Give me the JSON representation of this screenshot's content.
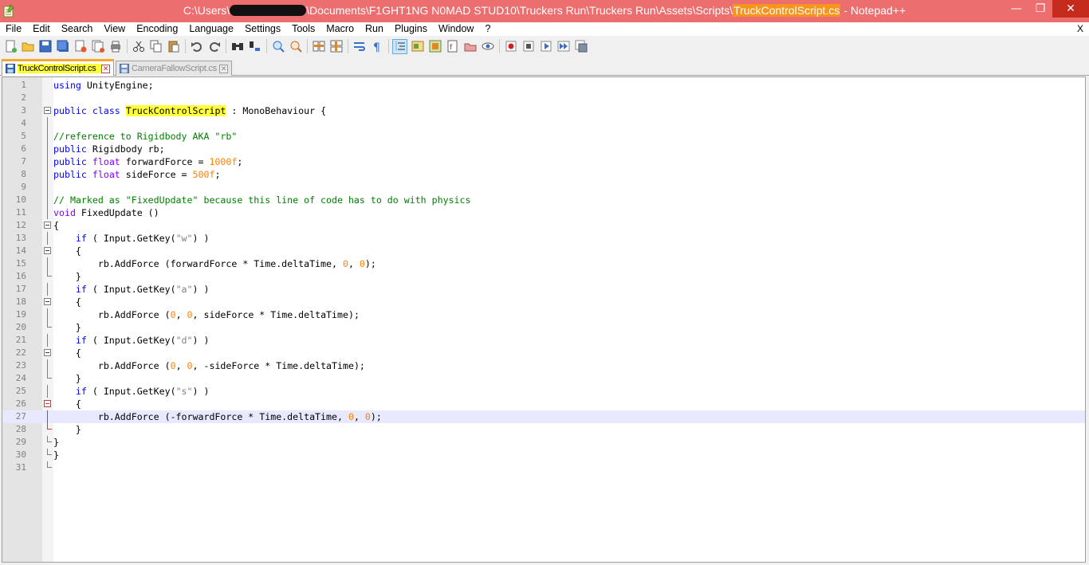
{
  "window": {
    "title_path": "C:\\Users\\",
    "title_mid": "\\Documents\\F1GHT1NG N0MAD STUD10\\Truckers Run\\Truckers Run\\Assets\\Scripts\\",
    "title_file": "TruckControlScript.cs",
    "title_app": " - Notepad++",
    "min_glyph": "—",
    "max_glyph": "❐",
    "close_glyph": "✕"
  },
  "menu": {
    "items": [
      "File",
      "Edit",
      "Search",
      "View",
      "Encoding",
      "Language",
      "Settings",
      "Tools",
      "Macro",
      "Run",
      "Plugins",
      "Window",
      "?"
    ],
    "close_doc": "X"
  },
  "tabs": [
    {
      "label": "TruckControlScript.cs",
      "active": true
    },
    {
      "label": "CameraFallowScript.cs",
      "active": false
    }
  ],
  "tab_close_glyph": "✕",
  "editor": {
    "current_line": 27,
    "lines": [
      {
        "n": "1",
        "t": [
          [
            "kw",
            "using"
          ],
          [
            "",
            " UnityEngine;"
          ]
        ]
      },
      {
        "n": "2",
        "t": []
      },
      {
        "n": "3",
        "t": [
          [
            "kw",
            "public"
          ],
          [
            "",
            " "
          ],
          [
            "kw",
            "class"
          ],
          [
            "",
            " "
          ],
          [
            "hlw",
            "TruckControlScript"
          ],
          [
            "",
            " : MonoBehaviour {"
          ]
        ]
      },
      {
        "n": "4",
        "t": []
      },
      {
        "n": "5",
        "t": [
          [
            "cm",
            "//reference to Rigidbody AKA \"rb\""
          ]
        ]
      },
      {
        "n": "6",
        "t": [
          [
            "kw",
            "public"
          ],
          [
            "",
            " Rigidbody rb;"
          ]
        ]
      },
      {
        "n": "7",
        "t": [
          [
            "kw",
            "public"
          ],
          [
            "",
            " "
          ],
          [
            "kw2",
            "float"
          ],
          [
            "",
            " forwardForce = "
          ],
          [
            "num",
            "1000f"
          ],
          [
            "",
            ";"
          ]
        ]
      },
      {
        "n": "8",
        "t": [
          [
            "kw",
            "public"
          ],
          [
            "",
            " "
          ],
          [
            "kw2",
            "float"
          ],
          [
            "",
            " sideForce = "
          ],
          [
            "num",
            "500f"
          ],
          [
            "",
            ";"
          ]
        ]
      },
      {
        "n": "9",
        "t": []
      },
      {
        "n": "10",
        "t": [
          [
            "cm",
            "// Marked as \"FixedUpdate\" because this line of code has to do with physics"
          ]
        ]
      },
      {
        "n": "11",
        "t": [
          [
            "kw2",
            "void"
          ],
          [
            "",
            " FixedUpdate ()"
          ]
        ]
      },
      {
        "n": "12",
        "t": [
          [
            "",
            "{"
          ]
        ]
      },
      {
        "n": "13",
        "t": [
          [
            "",
            "    "
          ],
          [
            "kw",
            "if"
          ],
          [
            "",
            " ( Input.GetKey("
          ],
          [
            "str",
            "\"w\""
          ],
          [
            "",
            ") )"
          ]
        ]
      },
      {
        "n": "14",
        "t": [
          [
            "",
            "    {"
          ]
        ]
      },
      {
        "n": "15",
        "t": [
          [
            "",
            "        rb.AddForce (forwardForce * Time.deltaTime, "
          ],
          [
            "num",
            "0"
          ],
          [
            "",
            ", "
          ],
          [
            "num",
            "0"
          ],
          [
            "",
            ");"
          ]
        ]
      },
      {
        "n": "16",
        "t": [
          [
            "",
            "    }"
          ]
        ]
      },
      {
        "n": "17",
        "t": [
          [
            "",
            "    "
          ],
          [
            "kw",
            "if"
          ],
          [
            "",
            " ( Input.GetKey("
          ],
          [
            "str",
            "\"a\""
          ],
          [
            "",
            ") )"
          ]
        ]
      },
      {
        "n": "18",
        "t": [
          [
            "",
            "    {"
          ]
        ]
      },
      {
        "n": "19",
        "t": [
          [
            "",
            "        rb.AddForce ("
          ],
          [
            "num",
            "0"
          ],
          [
            "",
            ", "
          ],
          [
            "num",
            "0"
          ],
          [
            "",
            ", sideForce * Time.deltaTime);"
          ]
        ]
      },
      {
        "n": "20",
        "t": [
          [
            "",
            "    }"
          ]
        ]
      },
      {
        "n": "21",
        "t": [
          [
            "",
            "    "
          ],
          [
            "kw",
            "if"
          ],
          [
            "",
            " ( Input.GetKey("
          ],
          [
            "str",
            "\"d\""
          ],
          [
            "",
            ") )"
          ]
        ]
      },
      {
        "n": "22",
        "t": [
          [
            "",
            "    {"
          ]
        ]
      },
      {
        "n": "23",
        "t": [
          [
            "",
            "        rb.AddForce ("
          ],
          [
            "num",
            "0"
          ],
          [
            "",
            ", "
          ],
          [
            "num",
            "0"
          ],
          [
            "",
            ", -sideForce * Time.deltaTime);"
          ]
        ]
      },
      {
        "n": "24",
        "t": [
          [
            "",
            "    }"
          ]
        ]
      },
      {
        "n": "25",
        "t": [
          [
            "",
            "    "
          ],
          [
            "kw",
            "if"
          ],
          [
            "",
            " ( Input.GetKey("
          ],
          [
            "str",
            "\"s\""
          ],
          [
            "",
            ") )"
          ]
        ]
      },
      {
        "n": "26",
        "t": [
          [
            "",
            "    {"
          ]
        ]
      },
      {
        "n": "27",
        "t": [
          [
            "",
            "        rb.AddForce (-forwardForce * Time.deltaTime, "
          ],
          [
            "num",
            "0"
          ],
          [
            "",
            ", "
          ],
          [
            "num",
            "0"
          ],
          [
            "",
            ");"
          ]
        ]
      },
      {
        "n": "28",
        "t": [
          [
            "",
            "    }"
          ]
        ]
      },
      {
        "n": "29",
        "t": [
          [
            "",
            "}"
          ]
        ]
      },
      {
        "n": "30",
        "t": [
          [
            "",
            "}"
          ]
        ]
      },
      {
        "n": "31",
        "t": []
      }
    ]
  },
  "toolbar_icons": [
    "new-file-icon",
    "open-file-icon",
    "save-icon",
    "save-all-icon",
    "close-icon",
    "close-all-icon",
    "print-icon",
    "|",
    "cut-icon",
    "copy-icon",
    "paste-icon",
    "|",
    "undo-icon",
    "redo-icon",
    "|",
    "find-icon",
    "replace-icon",
    "|",
    "zoom-in-icon",
    "zoom-out-icon",
    "|",
    "sync-vertical-icon",
    "sync-horizontal-icon",
    "|",
    "word-wrap-icon",
    "show-all-chars-icon",
    "|",
    "indent-guide-icon",
    "udl-icon",
    "doc-map-icon",
    "function-list-icon",
    "folder-workspace-icon",
    "monitoring-icon",
    "|",
    "record-macro-icon",
    "stop-macro-icon",
    "play-macro-icon",
    "run-macro-multiple-icon",
    "save-macro-icon"
  ],
  "colors": {
    "titlebar": "#ec6e6e",
    "highlight_yellow": "#ffff3a",
    "tab_accent": "#f7a72c",
    "current_line": "#e8e8ff"
  }
}
